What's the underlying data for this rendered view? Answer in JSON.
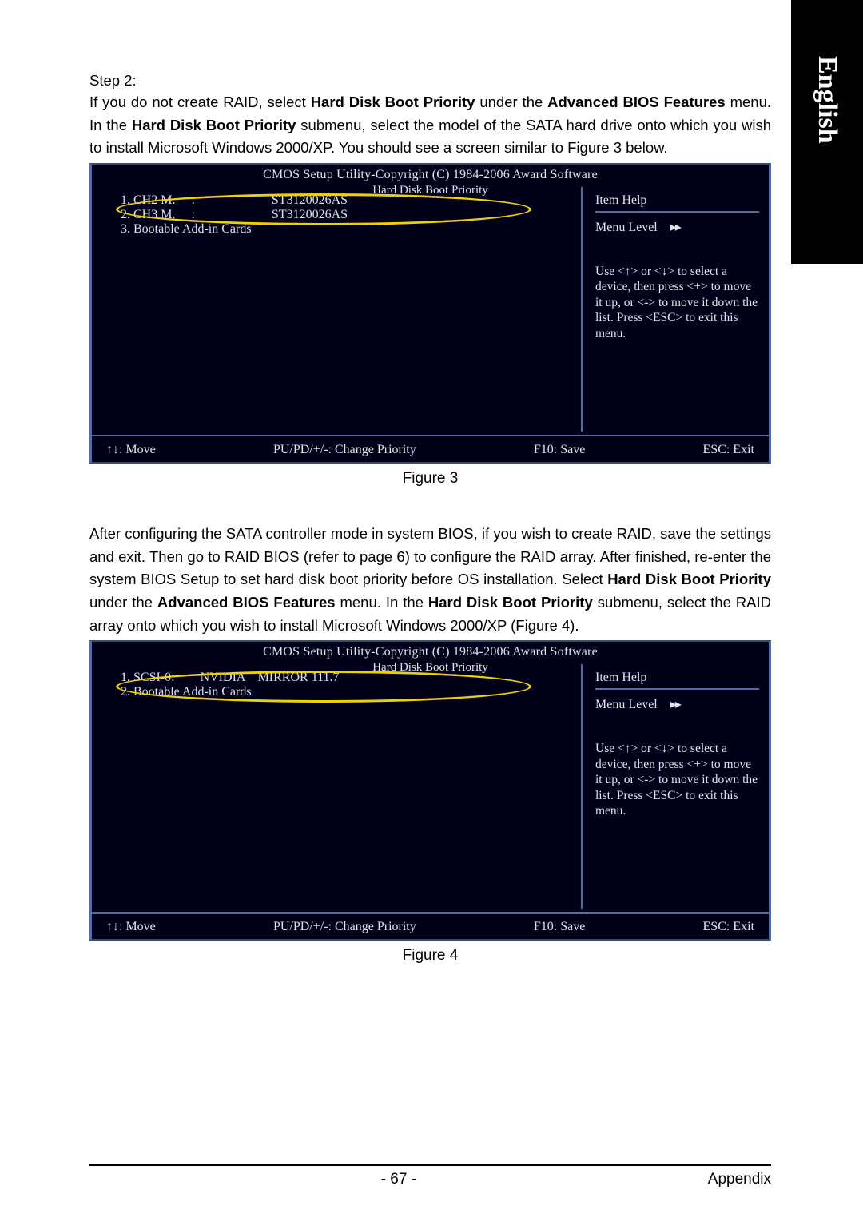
{
  "sideTab": "English",
  "step": {
    "label": "Step 2:",
    "para1_a": "If you do not create RAID, select ",
    "bold1": "Hard Disk Boot Priority",
    "para1_b": " under the ",
    "bold2": "Advanced BIOS Features",
    "para1_c": " menu. In the ",
    "bold3": "Hard Disk Boot Priority",
    "para1_d": " submenu, select the model of the SATA hard drive onto which you wish to install Microsoft Windows 2000/XP. You should see a screen similar to Figure 3 below."
  },
  "bios_common": {
    "copyright": "CMOS Setup Utility-Copyright (C) 1984-2006 Award Software",
    "subtitle": "Hard Disk Boot Priority",
    "itemHelp": "Item Help",
    "menuLevel": "Menu Level",
    "arrows": "▸▸",
    "instructions": "Use <↑>    or <↓> to select a device, then press <+> to move it up, or <-> to move it down the list. Press <ESC> to exit this menu.",
    "footer": {
      "move": "↑↓: Move",
      "change": "PU/PD/+/-: Change Priority",
      "save": "F10: Save",
      "exit": "ESC: Exit"
    }
  },
  "bios1": {
    "rows": [
      "1. CH2 M.     :                        ST3120026AS",
      "2. CH3 M.     :                        ST3120026AS",
      "3. Bootable Add-in Cards"
    ],
    "figcap": "Figure 3"
  },
  "midpara": {
    "a": "After configuring the SATA controller mode in system BIOS, if you wish to create RAID, save the settings and exit. Then go to RAID BIOS (refer to page 6) to configure the RAID array. After finished, re-enter the system BIOS Setup to set hard disk boot priority before OS installation. Select ",
    "b1": "Hard Disk Boot Priority",
    "c": " under the ",
    "b2": "Advanced BIOS Features",
    "d": " menu. In the ",
    "b3": "Hard Disk Boot Priority",
    "e": " submenu, select the RAID array onto which you wish to install Microsoft Windows 2000/XP (Figure 4)."
  },
  "bios2": {
    "rows": [
      "1. SCSI-0:        NVIDIA    MIRROR 111.7",
      "2. Bootable Add-in Cards"
    ],
    "figcap": "Figure 4"
  },
  "pagefoot": {
    "num": "- 67 -",
    "label": "Appendix"
  }
}
